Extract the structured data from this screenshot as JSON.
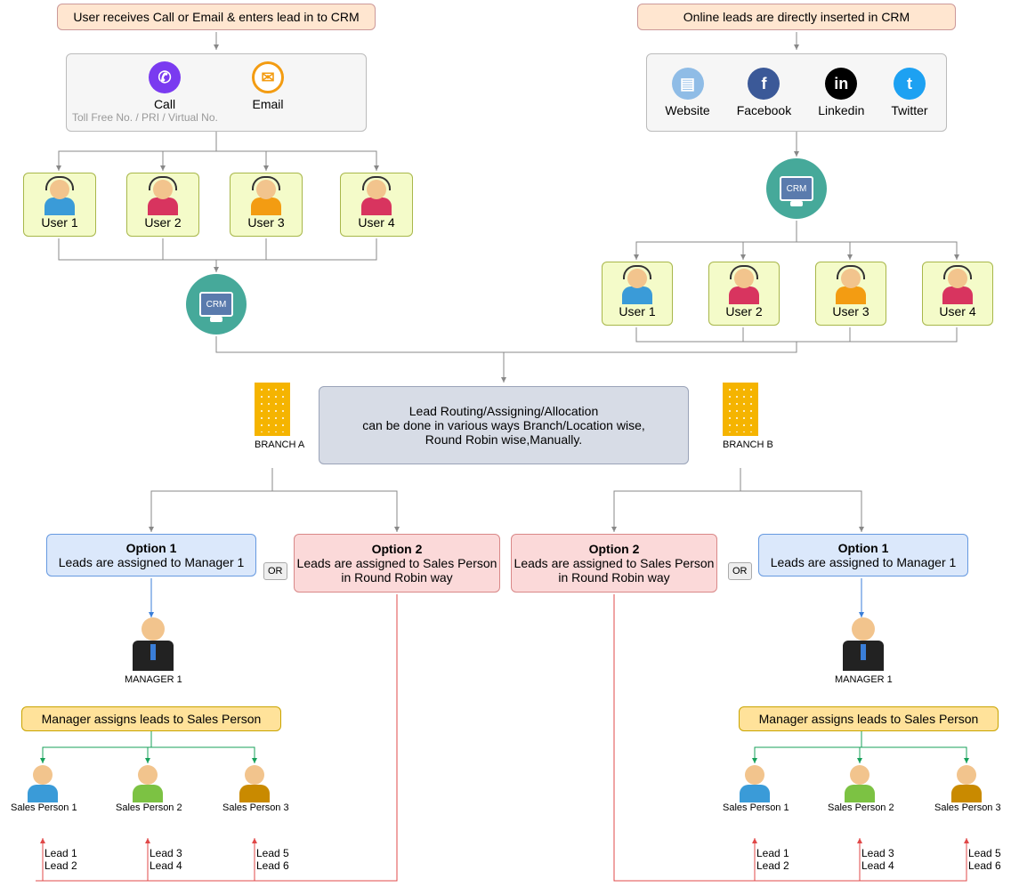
{
  "left": {
    "header": "User receives Call or Email & enters lead in to CRM",
    "call": "Call",
    "call_sub": "Toll Free No. / PRI / Virtual No.",
    "email": "Email",
    "users": [
      "User 1",
      "User 2",
      "User 3",
      "User 4"
    ],
    "crm": "CRM"
  },
  "right": {
    "header": "Online leads are directly inserted in CRM",
    "sources": [
      "Website",
      "Facebook",
      "Linkedin",
      "Twitter"
    ],
    "crm": "CRM",
    "users": [
      "User 1",
      "User 2",
      "User 3",
      "User 4"
    ]
  },
  "routing": {
    "line1": "Lead Routing/Assigning/Allocation",
    "line2": "can be done in various ways Branch/Location wise,",
    "line3": "Round Robin wise,Manually.",
    "branchA": "BRANCH A",
    "branchB": "BRANCH B"
  },
  "options": {
    "opt1_title": "Option 1",
    "opt1_text": "Leads are assigned to Manager 1",
    "opt2_title": "Option 2",
    "opt2_text": "Leads are assigned to Sales Person in Round Robin way",
    "or": "OR",
    "manager": "MANAGER 1",
    "manager_assign": "Manager assigns leads to Sales Person",
    "sales": [
      "Sales Person 1",
      "Sales Person 2",
      "Sales Person 3"
    ],
    "leads": [
      "Lead 1",
      "Lead 2",
      "Lead 3",
      "Lead 4",
      "Lead 5",
      "Lead 6"
    ]
  },
  "colors": {
    "purple": "#7a3bf0",
    "orange": "#f39c12",
    "fb": "#3b5998",
    "in": "#000",
    "tw": "#1da1f2",
    "web": "#8fbce6",
    "green": "#17a05a",
    "red": "#e04848",
    "blue": "#3a7ed8"
  }
}
